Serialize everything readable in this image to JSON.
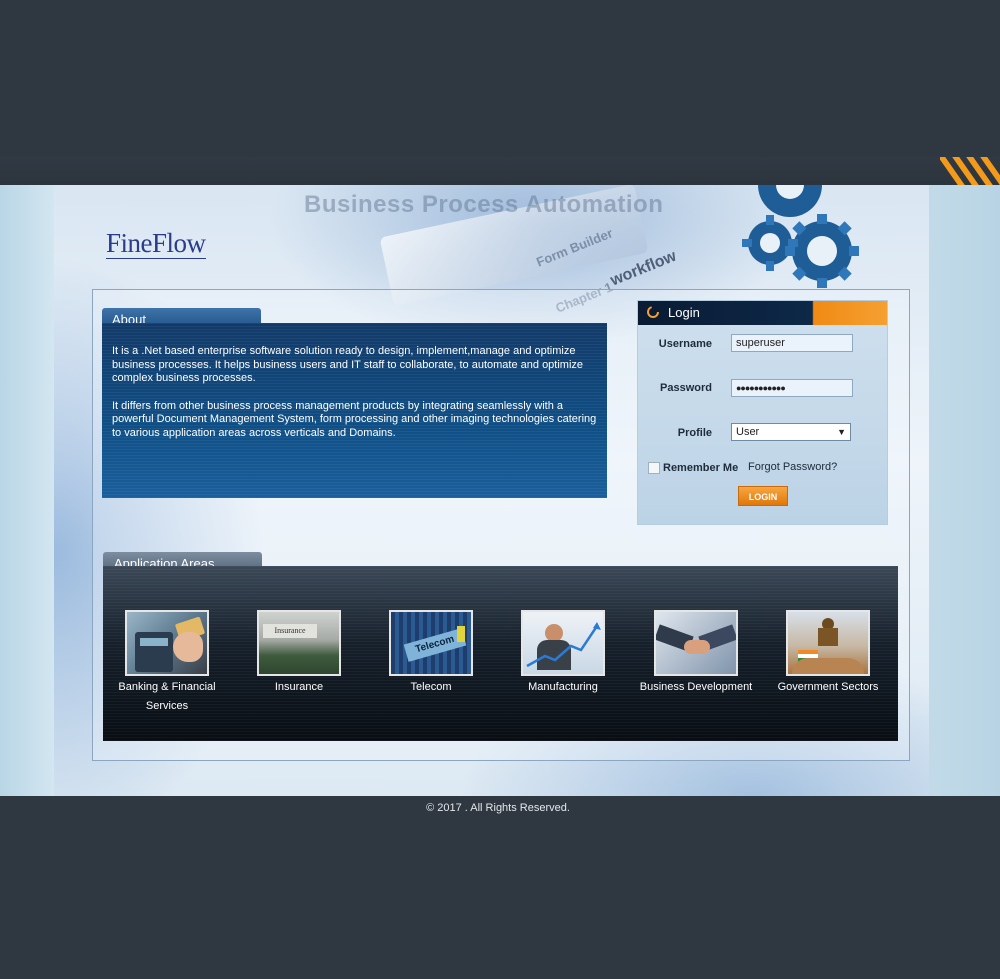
{
  "banner": {
    "title": "Business Process Automation",
    "logo": "FineFlow",
    "paper_texts": [
      "Form Builder",
      "Chapter 1",
      "workflow"
    ]
  },
  "about": {
    "heading": "About",
    "paragraphs": [
      "It is a .Net based enterprise software solution ready to design, implement,manage and optimize business processes. It helps business users and IT staff to collaborate, to automate and optimize complex business processes.",
      "It differs from other business process management products by integrating seamlessly with a powerful Document Management System, form processing and other imaging technologies catering to various application areas across verticals and Domains."
    ]
  },
  "login": {
    "heading": "Login",
    "username_label": "Username",
    "username_value": "superuser",
    "password_label": "Password",
    "password_value": "●●●●●●●●●●●",
    "profile_label": "Profile",
    "profile_value": "User",
    "remember_label": "Remember Me",
    "forgot_label": "Forgot Password?",
    "login_button": "LOGIN",
    "remember_checked": false
  },
  "applications": {
    "heading": "Application Areas",
    "items": [
      {
        "label": "Banking & Financial Services",
        "icon": "payment-terminal-icon"
      },
      {
        "label": "Insurance",
        "icon": "insurance-folder-icon"
      },
      {
        "label": "Telecom",
        "icon": "telecom-cable-icon"
      },
      {
        "label": "Manufacturing",
        "icon": "growth-chart-icon"
      },
      {
        "label": "Business Development",
        "icon": "handshake-icon"
      },
      {
        "label": "Government Sectors",
        "icon": "emblem-icon"
      }
    ]
  },
  "footer": {
    "text": "© 2017 . All Rights Reserved."
  },
  "colors": {
    "page_background": "#2f3741",
    "accent_orange": "#f49a1b",
    "about_blue": "#0f4f86",
    "login_header": "#0d2848"
  }
}
